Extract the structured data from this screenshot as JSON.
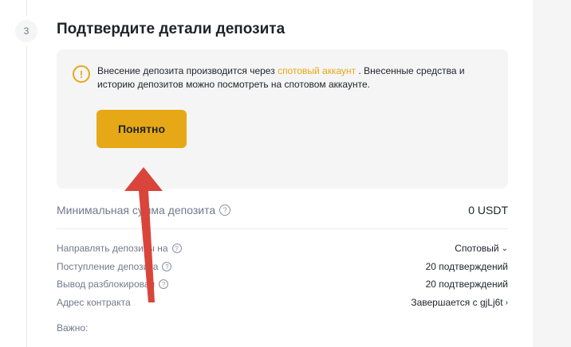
{
  "step": {
    "number": "3",
    "title": "Подтвердите детали депозита"
  },
  "notice": {
    "text_before": "Внесение депозита производится через ",
    "link": "спотовый аккаунт",
    "text_after": " . Внесенные средства и историю депозитов можно посмотреть на спотовом аккаунте.",
    "button": "Понятно"
  },
  "min_deposit": {
    "label": "Минимальная сумма депозита",
    "value": "0 USDT"
  },
  "rows": [
    {
      "label": "Направлять депозиты на",
      "value": "Спотовый"
    },
    {
      "label": "Поступление депозита",
      "value": "20 подтверждений"
    },
    {
      "label": "Вывод разблокирован",
      "value": "20 подтверждений"
    },
    {
      "label": "Адрес контракта",
      "value": "Завершается с gjLj6t"
    }
  ],
  "important": "Важно:",
  "icons": {
    "notice": "warning-icon",
    "help": "help-icon",
    "arrow": "red-arrow-annotation"
  },
  "colors": {
    "accent": "#e7a817",
    "annotation": "#d9453a"
  }
}
